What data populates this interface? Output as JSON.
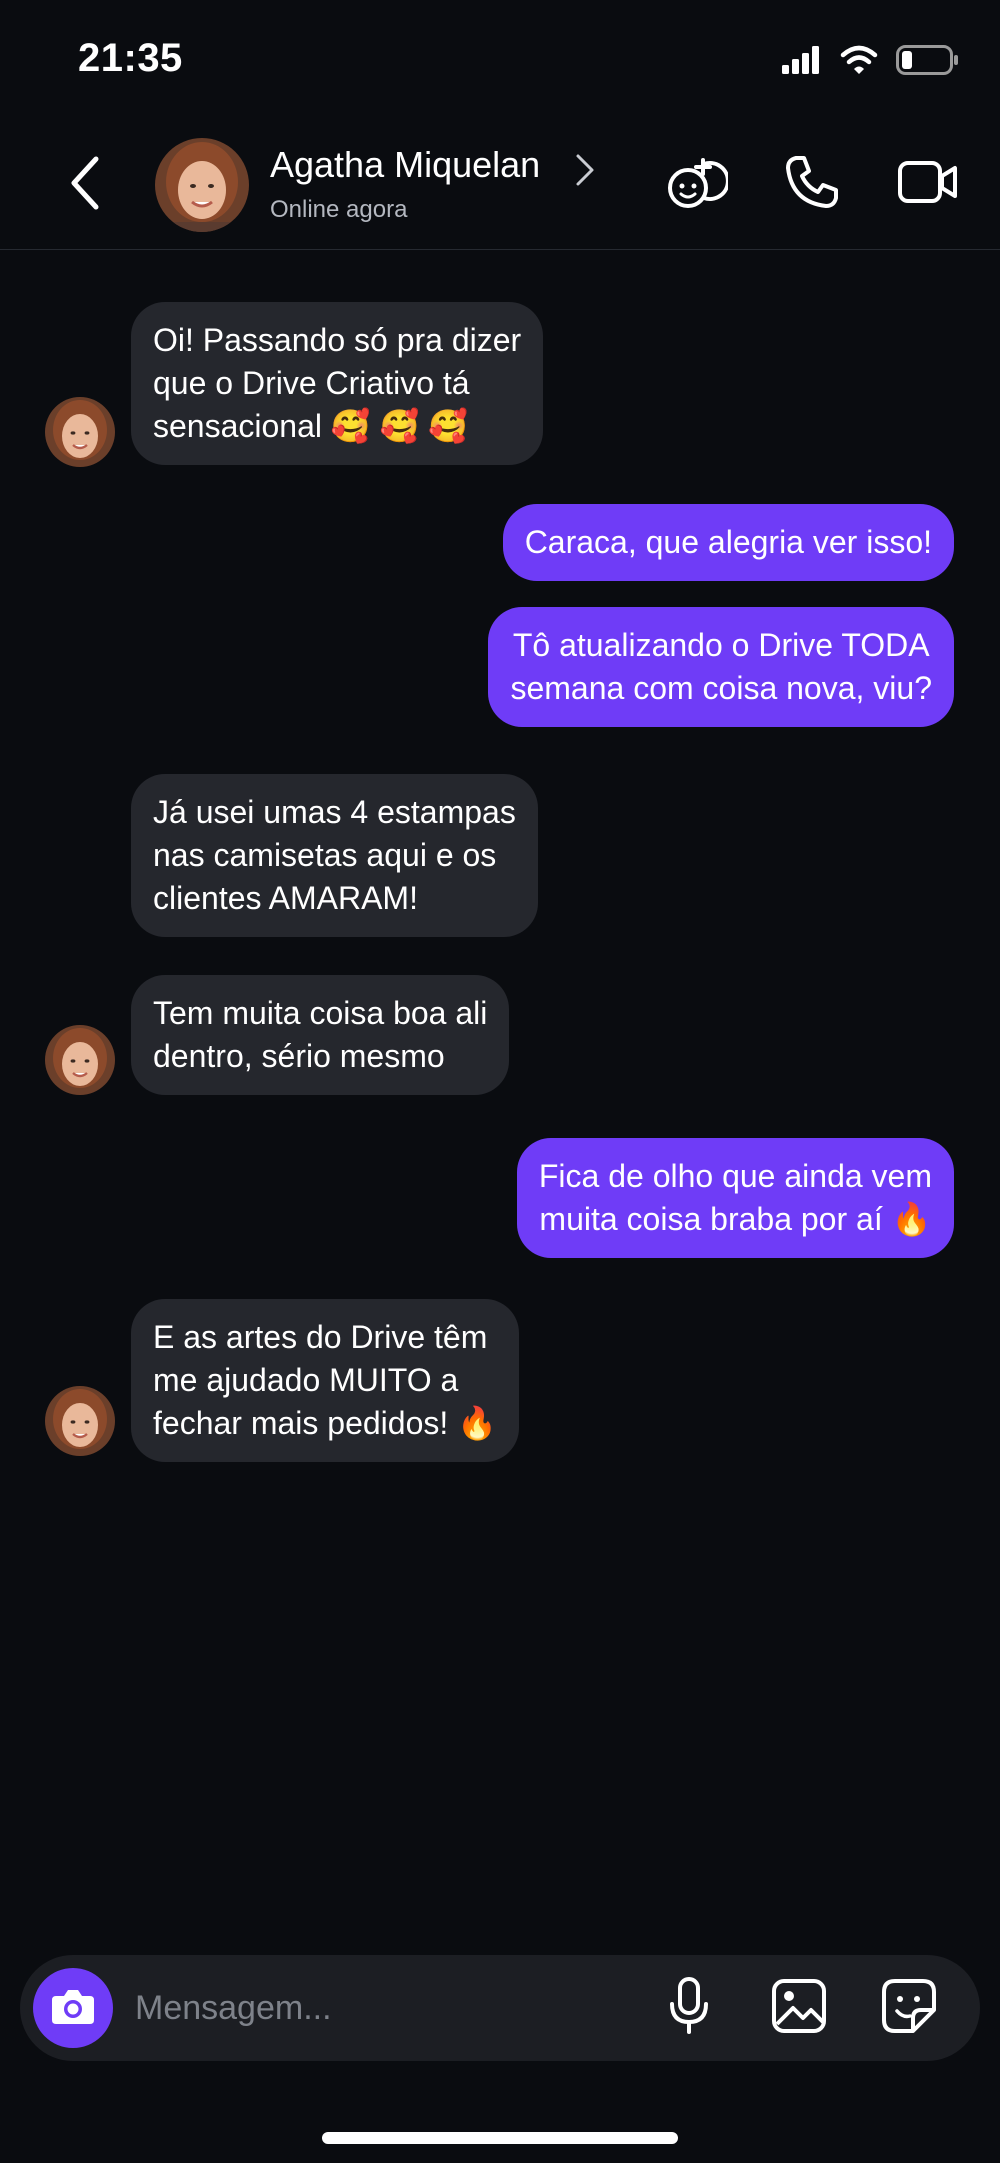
{
  "status_bar": {
    "time": "21:35"
  },
  "header": {
    "contact_name": "Agatha Miquelan",
    "contact_status": "Online agora"
  },
  "messages": [
    {
      "side": "in",
      "lines": [
        "Oi! Passando só pra dizer",
        "que o Drive Criativo tá",
        "sensacional 🥰 🥰 🥰"
      ],
      "avatar": true
    },
    {
      "side": "out",
      "lines": [
        "Caraca, que alegria ver isso!"
      ]
    },
    {
      "side": "out",
      "lines": [
        "Tô atualizando o Drive TODA",
        "semana com coisa nova, viu?"
      ]
    },
    {
      "side": "in",
      "lines": [
        "Já usei umas 4 estampas",
        "nas camisetas aqui e os",
        "clientes AMARAM!"
      ],
      "avatar": false
    },
    {
      "side": "in",
      "lines": [
        "Tem muita coisa boa ali",
        "dentro, sério mesmo"
      ],
      "avatar": true
    },
    {
      "side": "out",
      "lines": [
        "Fica de olho que ainda vem",
        "muita coisa braba por aí 🔥"
      ]
    },
    {
      "side": "in",
      "lines": [
        "E as artes do Drive têm",
        "me ajudado MUITO a",
        "fechar mais pedidos! 🔥"
      ],
      "avatar": true
    }
  ],
  "composer": {
    "placeholder": "Mensagem..."
  },
  "icons": {
    "back": "chevron-left-icon",
    "add_contact": "add-people-icon",
    "call": "phone-icon",
    "video": "video-camera-icon",
    "camera": "camera-icon",
    "mic": "microphone-icon",
    "gallery": "image-icon",
    "sticker": "sticker-icon"
  },
  "colors": {
    "background": "#0a0c10",
    "incoming_bubble": "#25272d",
    "outgoing_bubble": "#6f3cf7",
    "accent": "#6f3cf7"
  }
}
